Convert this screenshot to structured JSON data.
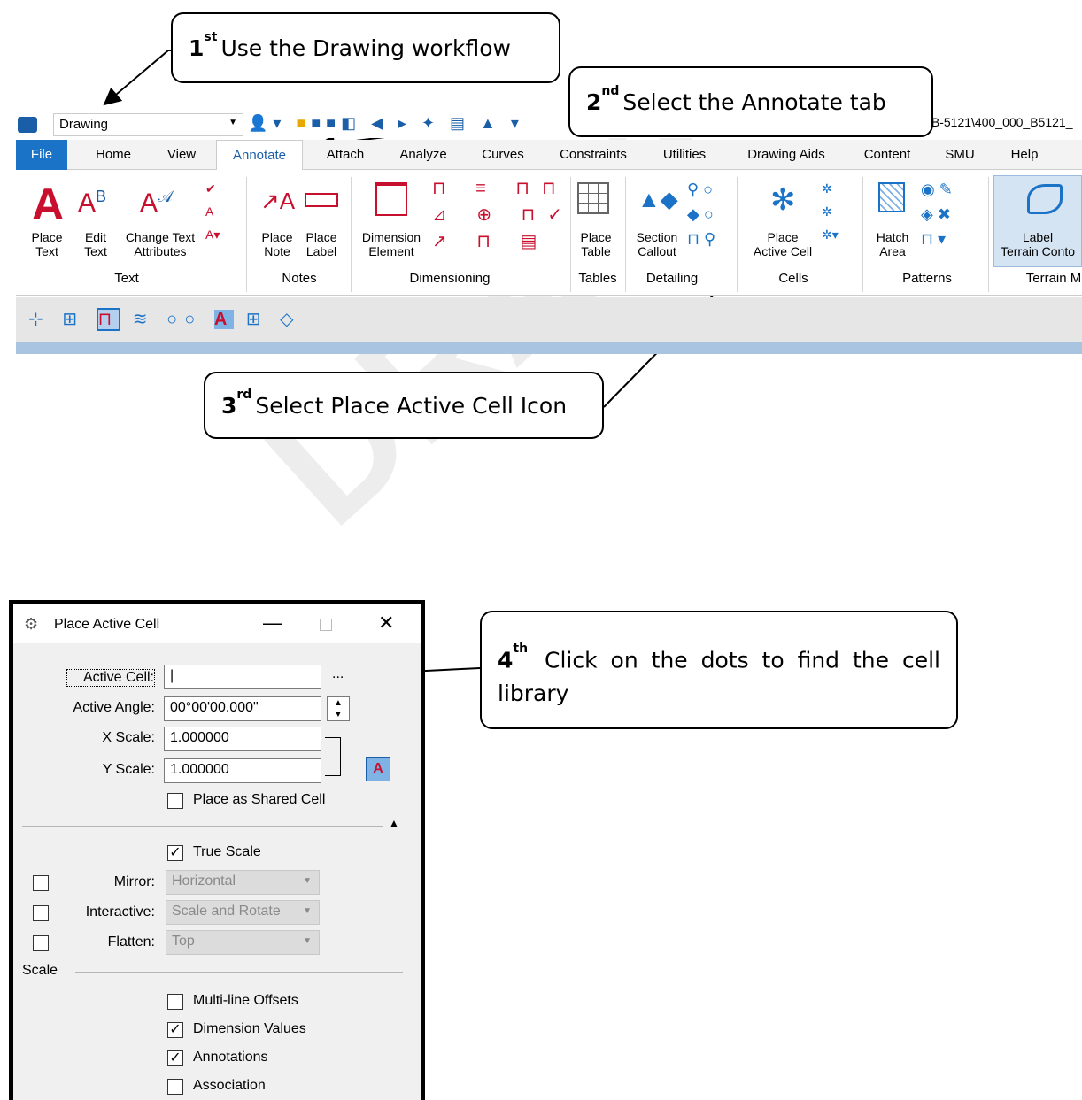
{
  "callouts": {
    "c1": {
      "num": "1",
      "sup": "st",
      "text": "Use the Drawing workflow"
    },
    "c2": {
      "num": "2",
      "sup": "nd",
      "text": "Select the Annotate tab"
    },
    "c3": {
      "num": "3",
      "sup": "rd",
      "text": "Select Place Active Cell Icon"
    },
    "c4": {
      "num": "4",
      "sup": "th",
      "text": "Click on the dots to find the cell library"
    }
  },
  "watermark": "DRAFT",
  "qat": {
    "workflow": "Drawing",
    "path": "\\B-5121\\400_000_B5121_"
  },
  "tabs": [
    "File",
    "Home",
    "View",
    "Annotate",
    "Attach",
    "Analyze",
    "Curves",
    "Constraints",
    "Utilities",
    "Drawing Aids",
    "Content",
    "SMU",
    "Help"
  ],
  "ribbon": {
    "place_text": "Place\nText",
    "edit_text": "Edit\nText",
    "change_text": "Change Text\nAttributes",
    "place_note": "Place\nNote",
    "place_label": "Place\nLabel",
    "dim_element": "Dimension\nElement",
    "place_table": "Place\nTable",
    "section_callout": "Section\nCallout",
    "place_active_cell": "Place\nActive Cell",
    "hatch_area": "Hatch\nArea",
    "label_terrain": "Label\nTerrain Conto",
    "groups": {
      "text": "Text",
      "notes": "Notes",
      "dimensioning": "Dimensioning",
      "tables": "Tables",
      "detailing": "Detailing",
      "cells": "Cells",
      "patterns": "Patterns",
      "terrain": "Terrain M"
    }
  },
  "dialog": {
    "title": "Place Active Cell",
    "active_cell_label": "Active Cell:",
    "active_cell_value": "|",
    "browse": "...",
    "active_angle_label": "Active Angle:",
    "active_angle_value": "00°00'00.000\"",
    "x_scale_label": "X Scale:",
    "x_scale_value": "1.000000",
    "y_scale_label": "Y Scale:",
    "y_scale_value": "1.000000",
    "shared_cell": "Place as Shared Cell",
    "true_scale": "True Scale",
    "mirror_label": "Mirror:",
    "mirror_value": "Horizontal",
    "interactive_label": "Interactive:",
    "interactive_value": "Scale and Rotate",
    "flatten_label": "Flatten:",
    "flatten_value": "Top",
    "scale_section": "Scale",
    "multiline": "Multi-line Offsets",
    "dim_values": "Dimension Values",
    "annotations": "Annotations",
    "association": "Association"
  }
}
